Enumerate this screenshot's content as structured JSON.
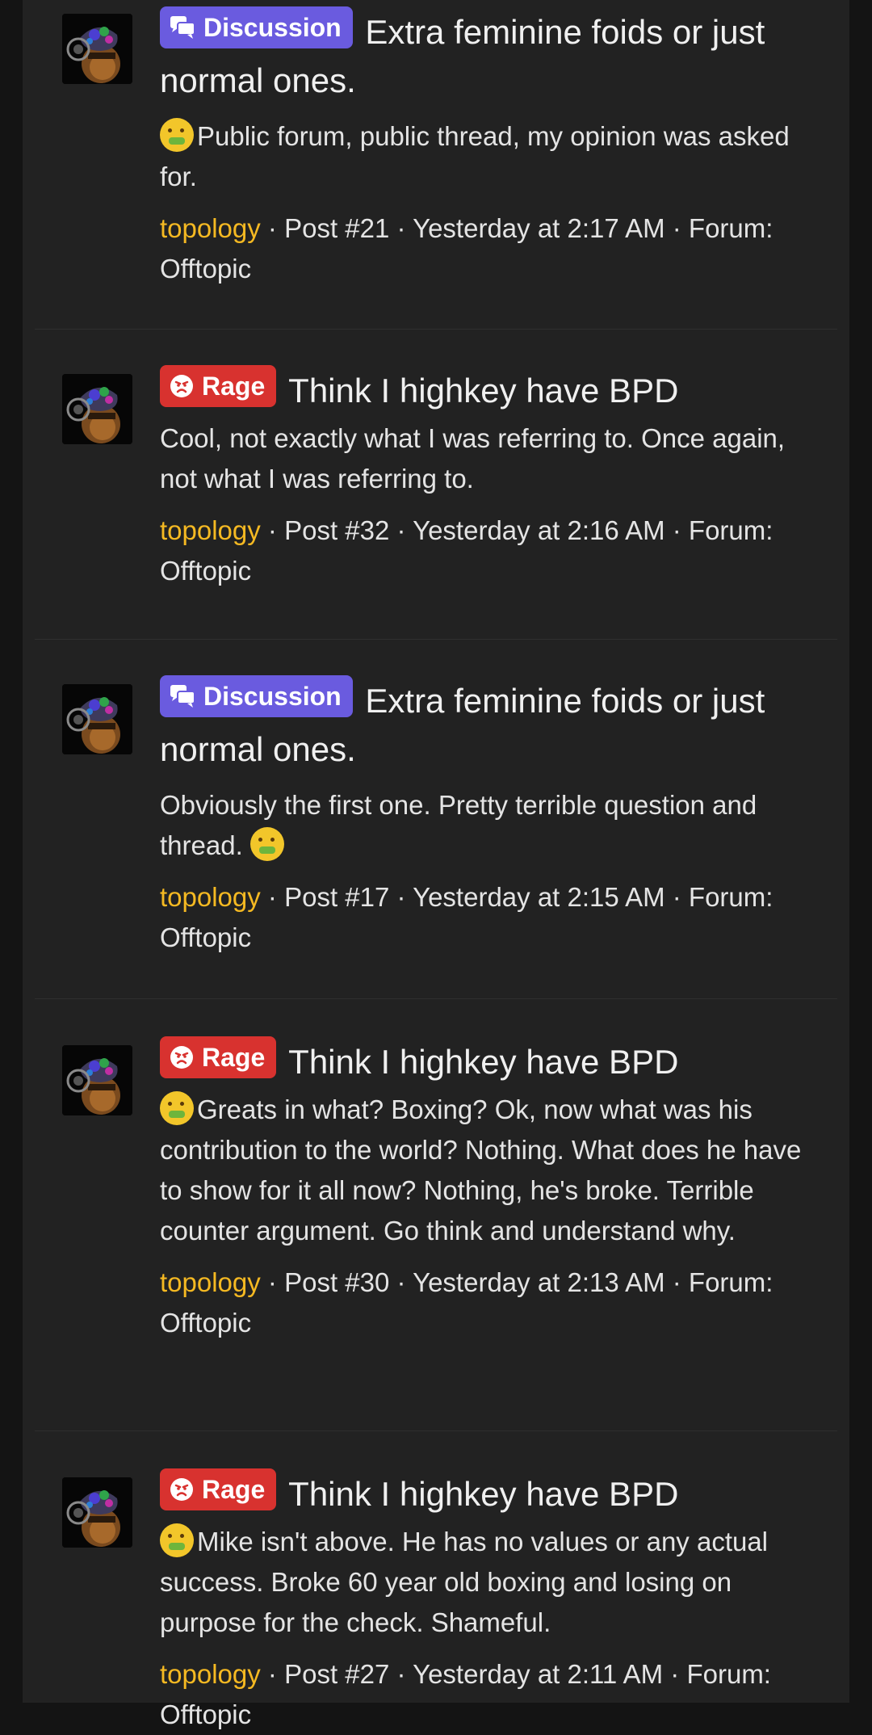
{
  "results": [
    {
      "badge": {
        "label": "Discussion",
        "type": "discussion",
        "icon": "chat-bubbles-icon"
      },
      "title": "Extra feminine foids or just normal ones.",
      "snippet_emoji": "nauseated-face-emoji",
      "snippet_prefix_emoji": true,
      "snippet_suffix_emoji": false,
      "snippet": "Public forum, public thread, my opinion was asked for.",
      "user": "topology",
      "post": "Post #21",
      "time": "Yesterday at 2:17 AM",
      "forum": "Forum: Offtopic"
    },
    {
      "badge": {
        "label": "Rage",
        "type": "rage",
        "icon": "angry-face-icon"
      },
      "title": "Think I highkey have BPD",
      "snippet_prefix_emoji": false,
      "snippet_suffix_emoji": false,
      "snippet": "Cool, not exactly what I was referring to. Once again, not what I was referring to.",
      "user": "topology",
      "post": "Post #32",
      "time": "Yesterday at 2:16 AM",
      "forum": "Forum: Offtopic"
    },
    {
      "badge": {
        "label": "Discussion",
        "type": "discussion",
        "icon": "chat-bubbles-icon"
      },
      "title": "Extra feminine foids or just normal ones.",
      "snippet_prefix_emoji": false,
      "snippet_suffix_emoji": true,
      "snippet": "Obviously the first one. Pretty terrible question and thread.",
      "user": "topology",
      "post": "Post #17",
      "time": "Yesterday at 2:15 AM",
      "forum": "Forum: Offtopic"
    },
    {
      "badge": {
        "label": "Rage",
        "type": "rage",
        "icon": "angry-face-icon"
      },
      "title": "Think I highkey have BPD",
      "snippet_prefix_emoji": true,
      "snippet_suffix_emoji": false,
      "snippet": "Greats in what? Boxing? Ok, now what was his contribution to the world? Nothing. What does he have to show for it all now? Nothing, he's broke. Terrible counter argument. Go think and understand why.",
      "user": "topology",
      "post": "Post #30",
      "time": "Yesterday at 2:13 AM",
      "forum": "Forum: Offtopic"
    },
    {
      "badge": {
        "label": "Rage",
        "type": "rage",
        "icon": "angry-face-icon"
      },
      "title": "Think I highkey have BPD",
      "snippet_prefix_emoji": true,
      "snippet_suffix_emoji": false,
      "snippet": "Mike isn't above. He has no values or any actual success. Broke 60 year old boxing and losing on purpose for the check. Shameful.",
      "user": "topology",
      "post": "Post #27",
      "time": "Yesterday at 2:11 AM",
      "forum": "Forum: Offtopic"
    }
  ],
  "separator": " · ",
  "colors": {
    "background": "#222222",
    "username": "#f5b922",
    "discussion_badge": "#6a5bdf",
    "rage_badge": "#d8322f"
  }
}
